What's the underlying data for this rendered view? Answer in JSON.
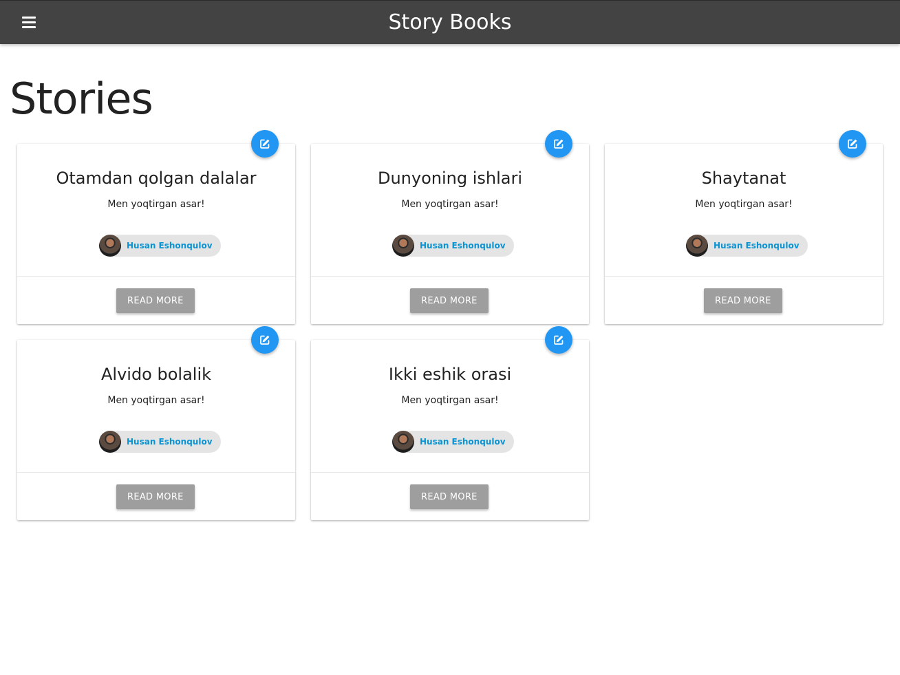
{
  "navbar": {
    "brand": "Story Books",
    "menu_icon": "hamburger-menu-icon"
  },
  "page": {
    "title": "Stories"
  },
  "colors": {
    "navbar": "#434343",
    "accent": "#2196f3",
    "author_link": "#0a93d3",
    "button": "#9e9e9e"
  },
  "stories": [
    {
      "title": "Otamdan qolgan dalalar",
      "body": "Men yoqtirgan asar!",
      "author": "Husan Eshonqulov",
      "action_label": "READ MORE",
      "edit_icon": "edit-icon"
    },
    {
      "title": "Dunyoning ishlari",
      "body": "Men yoqtirgan asar!",
      "author": "Husan Eshonqulov",
      "action_label": "READ MORE",
      "edit_icon": "edit-icon"
    },
    {
      "title": "Shaytanat",
      "body": "Men yoqtirgan asar!",
      "author": "Husan Eshonqulov",
      "action_label": "READ MORE",
      "edit_icon": "edit-icon"
    },
    {
      "title": "Alvido bolalik",
      "body": "Men yoqtirgan asar!",
      "author": "Husan Eshonqulov",
      "action_label": "READ MORE",
      "edit_icon": "edit-icon"
    },
    {
      "title": "Ikki eshik orasi",
      "body": "Men yoqtirgan asar!",
      "author": "Husan Eshonqulov",
      "action_label": "READ MORE",
      "edit_icon": "edit-icon"
    }
  ]
}
